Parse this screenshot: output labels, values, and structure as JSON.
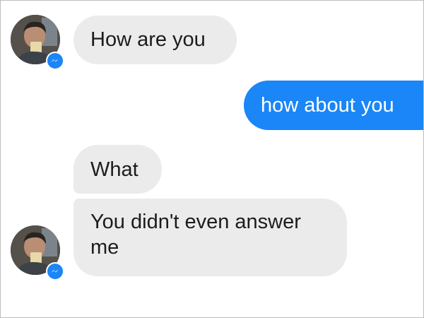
{
  "conversation": {
    "messages": [
      {
        "sender": "other",
        "text": "How are you"
      },
      {
        "sender": "me",
        "text": "how about you"
      },
      {
        "sender": "other",
        "text": "What"
      },
      {
        "sender": "other",
        "text": "You didn't even answer me"
      }
    ]
  },
  "icons": {
    "avatar": "profile-photo",
    "badge": "messenger-icon"
  },
  "colors": {
    "incoming_bubble": "#ebebeb",
    "outgoing_bubble": "#1a86f7",
    "badge": "#1a86f7",
    "text": "#1c1c1c"
  }
}
